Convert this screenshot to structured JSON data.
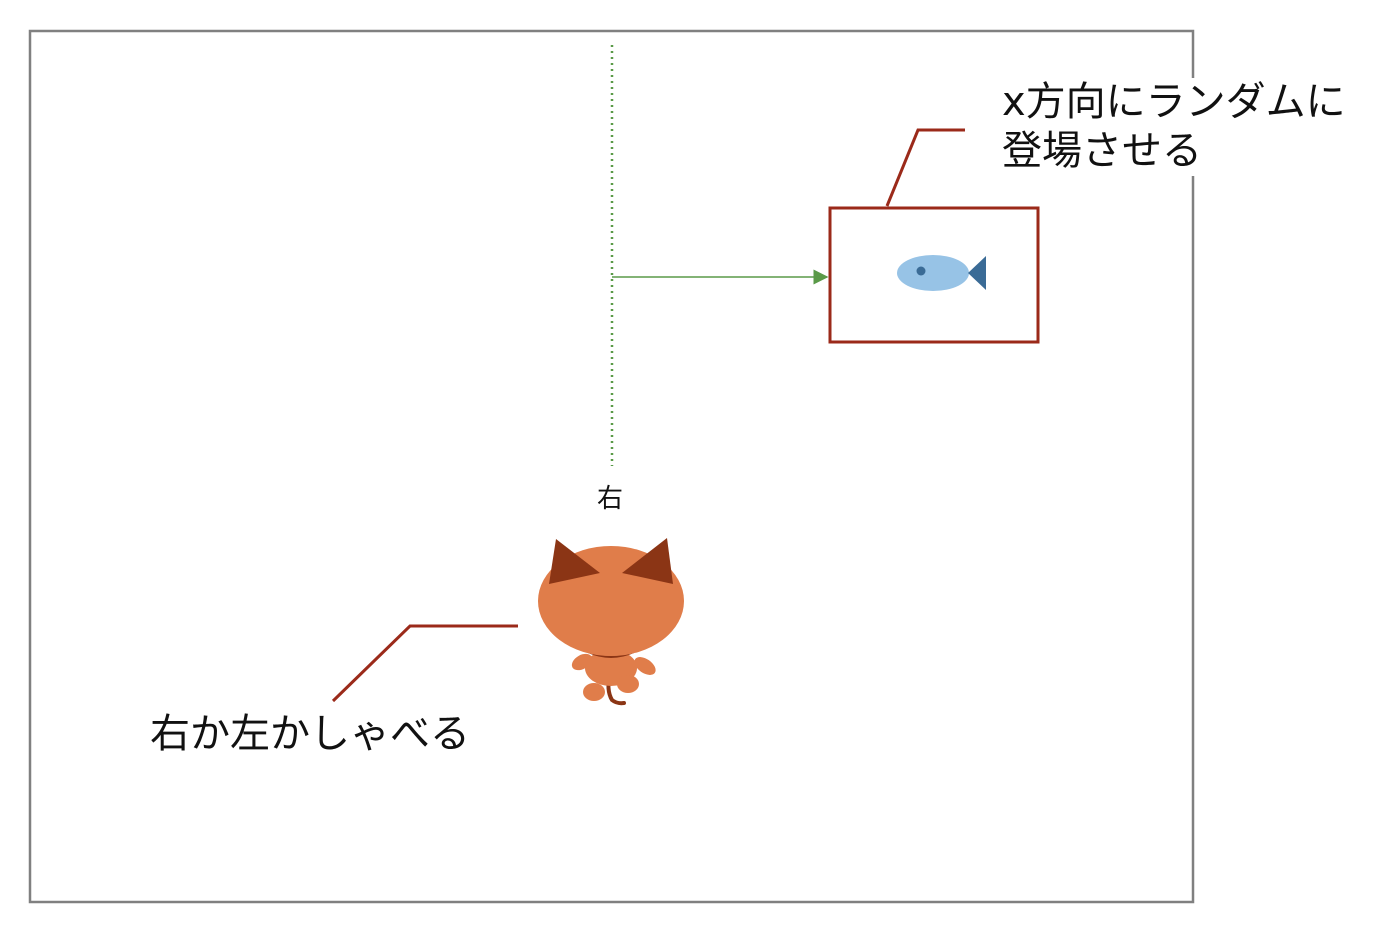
{
  "annotations": {
    "fish_callout": "x方向にランダムに\n登場させる",
    "cat_callout": "右か左かしゃべる"
  },
  "cat": {
    "speech": "右"
  },
  "colors": {
    "stage_border": "#808080",
    "callout_line": "#9b2a1a",
    "guide_line": "#5a9a48",
    "cat_body": "#e07d4a",
    "cat_ears": "#8b3515",
    "fish_body": "#97c3e6",
    "fish_tail": "#3a6b96"
  },
  "icons": [
    "cat-sprite-icon",
    "fish-sprite-icon"
  ]
}
